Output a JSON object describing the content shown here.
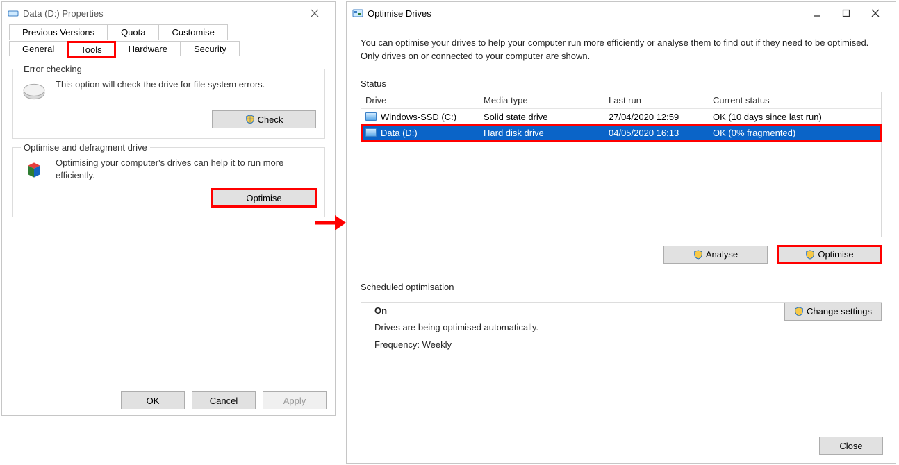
{
  "properties_window": {
    "title": "Data (D:) Properties",
    "tabs_row1": [
      "Previous Versions",
      "Quota",
      "Customise"
    ],
    "tabs_row2": [
      "General",
      "Tools",
      "Hardware",
      "Security"
    ],
    "active_tab": "Tools",
    "error_checking": {
      "group_label": "Error checking",
      "text": "This option will check the drive for file system errors.",
      "button": "Check"
    },
    "optimise": {
      "group_label": "Optimise and defragment drive",
      "text": "Optimising your computer's drives can help it to run more efficiently.",
      "button": "Optimise"
    },
    "buttons": {
      "ok": "OK",
      "cancel": "Cancel",
      "apply": "Apply"
    }
  },
  "optimise_window": {
    "title": "Optimise Drives",
    "intro": "You can optimise your drives to help your computer run more efficiently or analyse them to find out if they need to be optimised. Only drives on or connected to your computer are shown.",
    "status_label": "Status",
    "columns": {
      "drive": "Drive",
      "media": "Media type",
      "last_run": "Last run",
      "status": "Current status"
    },
    "rows": [
      {
        "drive": "Windows-SSD (C:)",
        "media": "Solid state drive",
        "last_run": "27/04/2020 12:59",
        "status": "OK (10 days since last run)",
        "selected": false
      },
      {
        "drive": "Data (D:)",
        "media": "Hard disk drive",
        "last_run": "04/05/2020 16:13",
        "status": "OK (0% fragmented)",
        "selected": true
      }
    ],
    "analyse_button": "Analyse",
    "optimise_button": "Optimise",
    "sched_label": "Scheduled optimisation",
    "sched_state": "On",
    "sched_text": "Drives are being optimised automatically.",
    "sched_freq": "Frequency: Weekly",
    "change_settings": "Change settings",
    "close": "Close"
  }
}
